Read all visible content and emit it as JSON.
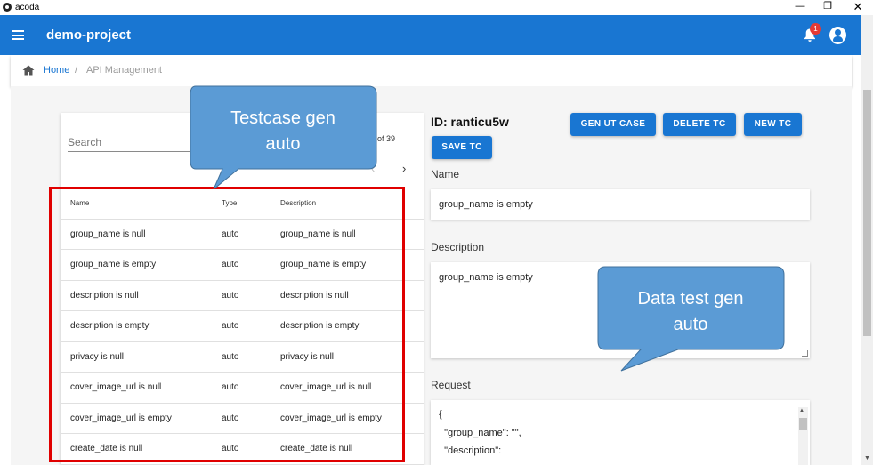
{
  "window": {
    "title": "acoda"
  },
  "app": {
    "project_name": "demo-project",
    "notification_count": "1"
  },
  "breadcrumb": {
    "home": "Home",
    "separator": "/",
    "current": "API Management"
  },
  "testcases": {
    "search_placeholder": "Search",
    "page_info": "of 39",
    "columns": [
      "Name",
      "Type",
      "Description"
    ],
    "rows": [
      {
        "name": "group_name is null",
        "type": "auto",
        "description": "group_name is null"
      },
      {
        "name": "group_name is empty",
        "type": "auto",
        "description": "group_name is empty"
      },
      {
        "name": "description is null",
        "type": "auto",
        "description": "description is null"
      },
      {
        "name": "description is empty",
        "type": "auto",
        "description": "description is empty"
      },
      {
        "name": "privacy is null",
        "type": "auto",
        "description": "privacy is null"
      },
      {
        "name": "cover_image_url is null",
        "type": "auto",
        "description": "cover_image_url is null"
      },
      {
        "name": "cover_image_url is empty",
        "type": "auto",
        "description": "cover_image_url is empty"
      },
      {
        "name": "create_date is null",
        "type": "auto",
        "description": "create_date is null"
      }
    ]
  },
  "detail": {
    "id_label": "ID: ranticu5w",
    "buttons": {
      "gen_ut": "GEN UT CASE",
      "delete": "DELETE TC",
      "new": "NEW TC",
      "save": "SAVE TC"
    },
    "name_label": "Name",
    "name_value": "group_name is empty",
    "description_label": "Description",
    "description_value": "group_name is empty",
    "request_label": "Request",
    "request_lines": [
      "{",
      "  \"group_name\": \"\",",
      "  \"description\":"
    ]
  },
  "annotations": {
    "callout1_line1": "Testcase gen",
    "callout1_line2": "auto",
    "callout2_line1": "Data test gen",
    "callout2_line2": "auto"
  },
  "colors": {
    "primary": "#1976d2",
    "badge": "#e53935",
    "highlight": "#e00000",
    "callout": "#5b9bd5"
  }
}
